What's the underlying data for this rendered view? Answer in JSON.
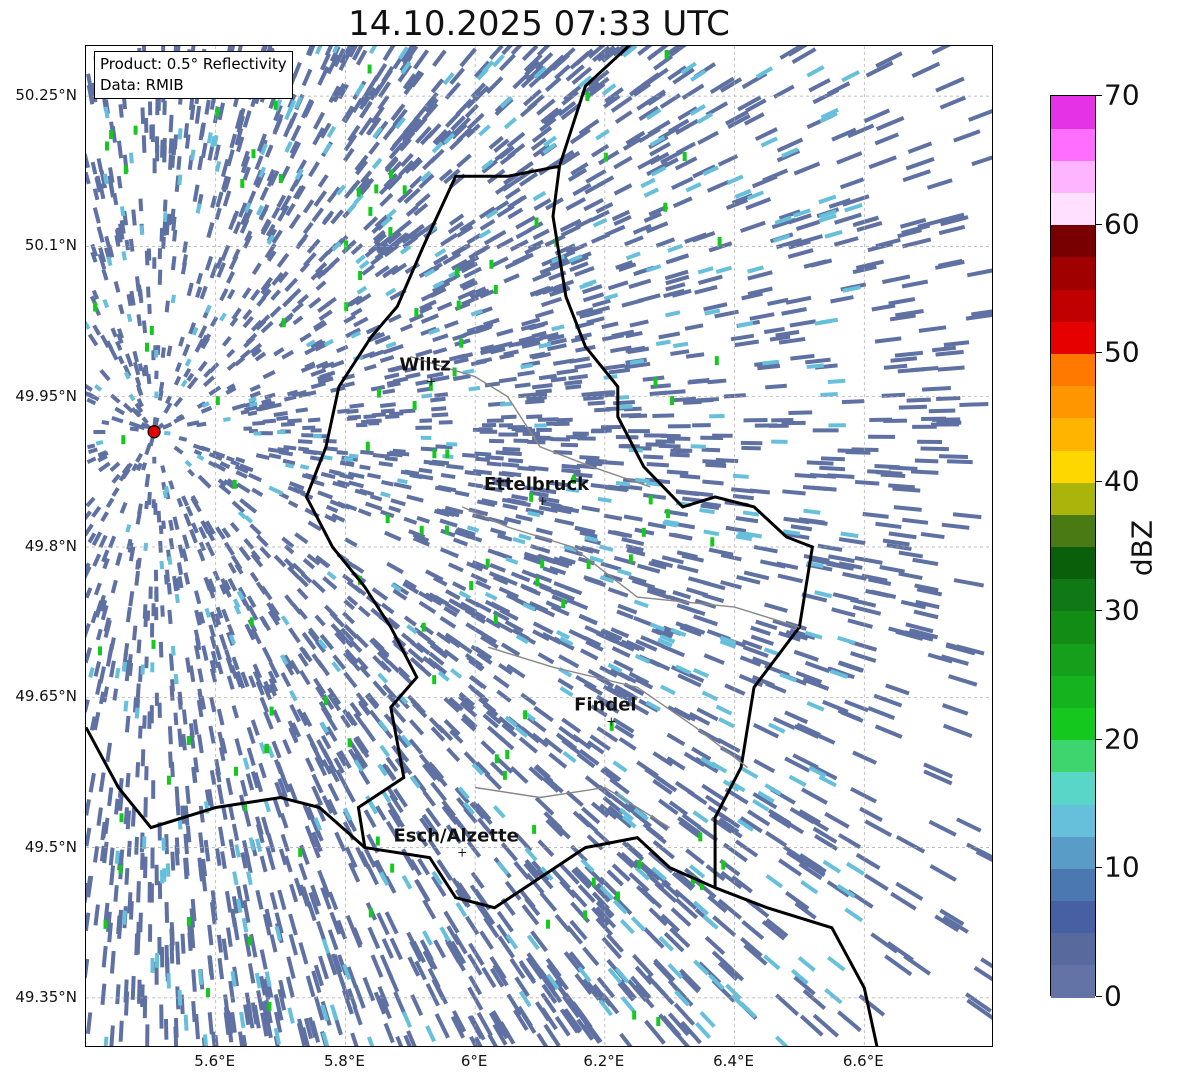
{
  "title": "14.10.2025 07:33 UTC",
  "product_box": {
    "product": "Product: 0.5° Reflectivity",
    "data": "Data: RMIB"
  },
  "map": {
    "lon_range": [
      5.4,
      6.8
    ],
    "lat_range": [
      49.3,
      50.3
    ],
    "lat_ticks": [
      {
        "value": 50.25,
        "label": "50.25°N"
      },
      {
        "value": 50.1,
        "label": "50.1°N"
      },
      {
        "value": 49.95,
        "label": "49.95°N"
      },
      {
        "value": 49.8,
        "label": "49.8°N"
      },
      {
        "value": 49.65,
        "label": "49.65°N"
      },
      {
        "value": 49.5,
        "label": "49.5°N"
      },
      {
        "value": 49.35,
        "label": "49.35°N"
      }
    ],
    "lon_ticks": [
      {
        "value": 5.6,
        "label": "5.6°E"
      },
      {
        "value": 5.8,
        "label": "5.8°E"
      },
      {
        "value": 6.0,
        "label": "6°E"
      },
      {
        "value": 6.2,
        "label": "6.2°E"
      },
      {
        "value": 6.4,
        "label": "6.4°E"
      },
      {
        "value": 6.6,
        "label": "6.6°E"
      }
    ],
    "radar_site": {
      "lon": 5.505,
      "lat": 49.915
    },
    "cities": [
      {
        "name": "Wiltz",
        "lon": 5.932,
        "lat": 49.966
      },
      {
        "name": "Ettelbruck",
        "lon": 6.104,
        "lat": 49.847
      },
      {
        "name": "Findel",
        "lon": 6.21,
        "lat": 49.627
      },
      {
        "name": "Esch/Alzette",
        "lon": 5.98,
        "lat": 49.496
      }
    ],
    "border_color": "#000000",
    "canton_color": "#888888"
  },
  "colorbar": {
    "label": "dBZ",
    "ticks": [
      {
        "value": 0,
        "label": "0"
      },
      {
        "value": 10,
        "label": "10"
      },
      {
        "value": 20,
        "label": "20"
      },
      {
        "value": 30,
        "label": "30"
      },
      {
        "value": 40,
        "label": "40"
      },
      {
        "value": 50,
        "label": "50"
      },
      {
        "value": 60,
        "label": "60"
      },
      {
        "value": 70,
        "label": "70"
      }
    ],
    "colors": [
      "#6473a6",
      "#566a9e",
      "#4660a3",
      "#4b78b0",
      "#5a9cc8",
      "#66c0dc",
      "#5ad6c8",
      "#3dd66e",
      "#14c81e",
      "#14b41e",
      "#14a01a",
      "#128c14",
      "#107814",
      "#0a5f0a",
      "#4a7a14",
      "#aab40a",
      "#ffd700",
      "#ffb400",
      "#ff9600",
      "#ff7800",
      "#e60000",
      "#c00000",
      "#a00000",
      "#780000",
      "#ffe0ff",
      "#ffb4ff",
      "#ff6eff",
      "#e632e6"
    ]
  }
}
